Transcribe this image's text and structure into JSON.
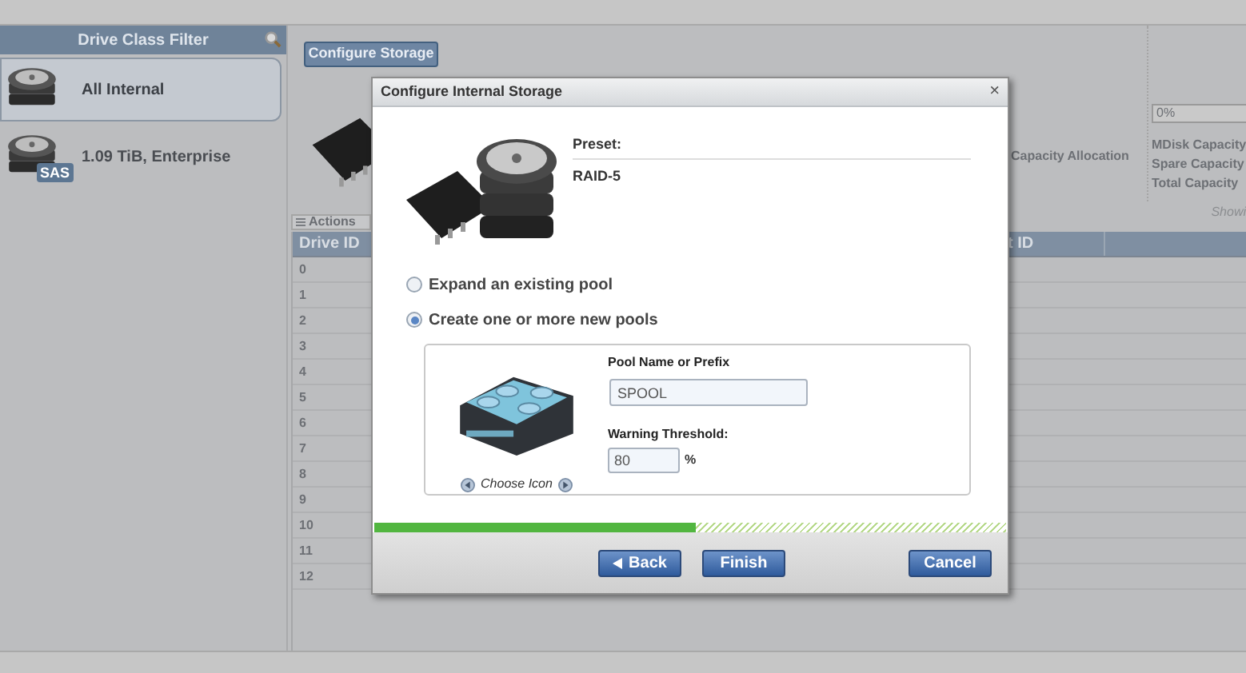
{
  "sidebar": {
    "title": "Drive Class Filter",
    "items": [
      {
        "label": "All Internal",
        "selected": true
      },
      {
        "label": "1.09 TiB, Enterprise",
        "badge": "SAS",
        "selected": false
      }
    ]
  },
  "toolbar": {
    "configure_button": "Configure Storage"
  },
  "summary": {
    "label": "Capacity Allocation",
    "progress_text": "0%",
    "level": 0,
    "capacity_labels": [
      "MDisk Capacity",
      "Spare Capacity",
      "Total Capacity"
    ],
    "showing": "Showi"
  },
  "table": {
    "actions": "Actions",
    "columns": [
      "Drive ID",
      "t ID"
    ],
    "rows": [
      "0",
      "1",
      "2",
      "3",
      "4",
      "5",
      "6",
      "7",
      "8",
      "9",
      "10",
      "11",
      "12"
    ]
  },
  "dialog": {
    "title": "Configure Internal Storage",
    "close": "×",
    "preset_label": "Preset:",
    "preset_value": "RAID-5",
    "options": [
      {
        "label": "Expand an existing pool",
        "selected": false
      },
      {
        "label": "Create one or more new pools",
        "selected": true
      }
    ],
    "pool_name_label": "Pool Name or Prefix",
    "pool_name": "SPOOL",
    "threshold_label": "Warning Threshold:",
    "threshold": "80",
    "threshold_unit": "%",
    "choose_icon": "Choose Icon",
    "level": 0.51,
    "buttons": [
      {
        "label": "Back",
        "kind": "back"
      },
      {
        "label": "Finish",
        "kind": "normal"
      },
      {
        "label": "Cancel",
        "kind": "cancel"
      }
    ]
  }
}
